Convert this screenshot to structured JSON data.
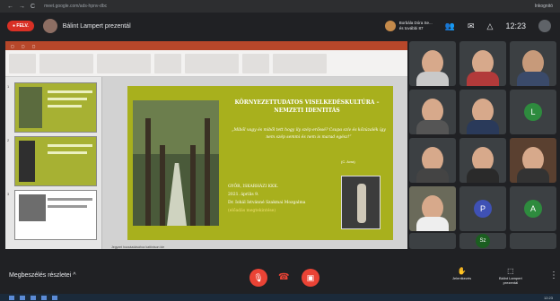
{
  "browser": {
    "url": "meet.google.com/ads-hpnv-dbc",
    "nav_back": "←",
    "nav_forward": "→",
    "nav_reload": "C",
    "profile_name": "Inkognitó"
  },
  "meet": {
    "record_badge": "● FELV.",
    "presenting_title": "Bálint Lampert prezentál",
    "pinned_user_line1": "Borbála Dóra Se...",
    "pinned_user_line2": "és további 87",
    "clock": "12:23"
  },
  "slide": {
    "title": "KÖRNYEZETTUDATOS VISELKEDÉSKULTÚRA – NEMZETI IDENTITÁS",
    "quote": "„Miből vagy és miből tett hogy ily szép erőssé? Csupa szív és kőzúzalék így nem szép semmi és nem is marad egész!”",
    "author": "(C. Avra)",
    "details_line1": "GYŐR, ISKARHÁZI KKK.",
    "details_line2": "2021. április 9.",
    "details_line3": "Dr. Iohál Istvánné Szakmai Mozgalma",
    "details_line4": "(előadás megtekintése)",
    "status_text": "Jegyzet hozzáadásához kattintson ide"
  },
  "thumbs": [
    {
      "num": "1"
    },
    {
      "num": "2"
    },
    {
      "num": "3"
    }
  ],
  "participants": {
    "letter_1": "L",
    "letter_2": "P",
    "letter_3": "A",
    "letter_4": "Sz"
  },
  "controls": {
    "meeting_details": "Megbeszélés részletei  ^",
    "mic_icon": "mic-off-icon",
    "cam_icon": "cam-off-icon",
    "raise_hand_label": "Jelentkezés",
    "present_label_1": "Bálint Lampert",
    "present_label_2": "prezentál"
  },
  "taskbar": {
    "time": "12:23"
  },
  "colors": {
    "slide_green": "#a8b01d",
    "record_red": "#d93025",
    "meet_bg": "#202124"
  }
}
